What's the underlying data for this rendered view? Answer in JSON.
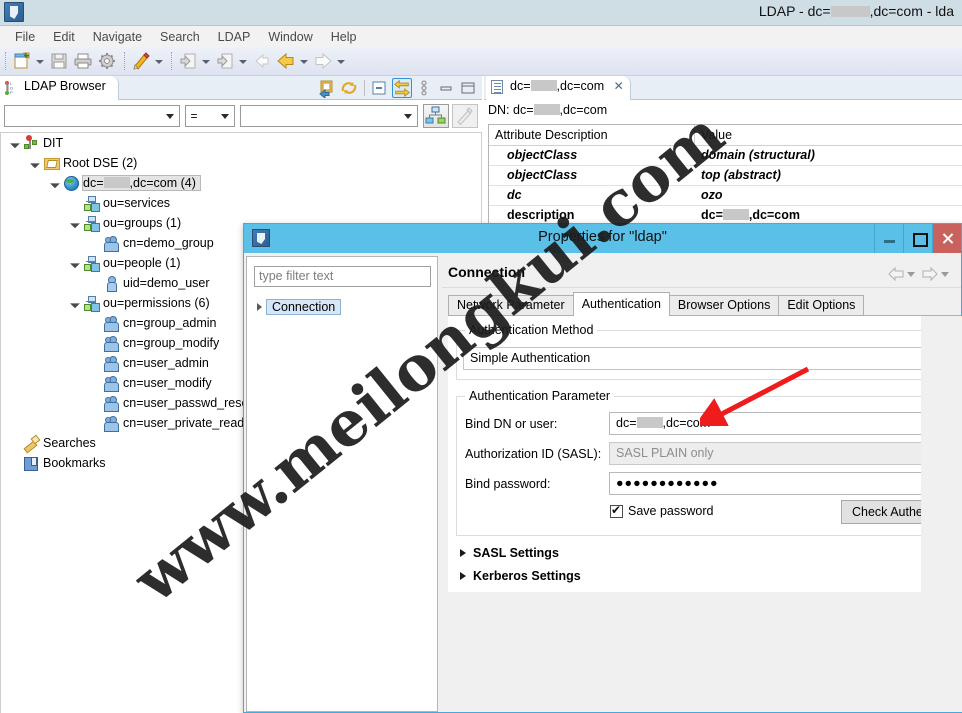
{
  "window": {
    "title": "LDAP - dc=███,dc=com - lda",
    "app_icon": "ldap-studio-icon"
  },
  "menubar": {
    "items": [
      "File",
      "Edit",
      "Navigate",
      "Search",
      "LDAP",
      "Window",
      "Help"
    ]
  },
  "toolbar": {
    "buttons": [
      {
        "name": "new-icon"
      },
      {
        "name": "new-dropdown-arrow"
      },
      {
        "name": "save-icon"
      },
      {
        "name": "print-icon"
      },
      {
        "name": "preferences-gear-icon"
      },
      {
        "name": "ldif-import-icon"
      },
      {
        "name": "ldif-dropdown-arrow"
      },
      {
        "name": "import-icon"
      },
      {
        "name": "import-dropdown-arrow"
      },
      {
        "name": "export-icon"
      },
      {
        "name": "export-dropdown-arrow"
      },
      {
        "name": "back-disabled-icon"
      },
      {
        "name": "back-icon"
      },
      {
        "name": "back-dropdown-arrow"
      },
      {
        "name": "forward-icon"
      },
      {
        "name": "forward-dropdown-arrow"
      }
    ]
  },
  "browser_view": {
    "tab_label": "LDAP Browser",
    "tools": [
      "link-with-editor-icon",
      "refresh-icon",
      "collapse-all-icon",
      "pin-icon",
      "view-menu-icon",
      "minimize-icon",
      "maximize-icon"
    ],
    "filter": {
      "attribute_value": "",
      "operator": "=",
      "value": "",
      "apply_button": "apply-filter-icon",
      "clear_button": "clear-filter-icon"
    },
    "tree": [
      {
        "label": "DIT",
        "indent": 0,
        "icon": "dit-icon",
        "twist": "open",
        "selected": false
      },
      {
        "label": "Root DSE (2)",
        "indent": 1,
        "icon": "root-dse-icon",
        "twist": "open",
        "selected": false
      },
      {
        "label": "dc=██,dc=com (4)",
        "indent": 2,
        "icon": "entry-globe-icon",
        "twist": "open",
        "selected": true
      },
      {
        "label": "ou=services",
        "indent": 3,
        "icon": "ou-icon",
        "twist": "none",
        "selected": false
      },
      {
        "label": "ou=groups (1)",
        "indent": 3,
        "icon": "ou-icon",
        "twist": "open",
        "selected": false
      },
      {
        "label": "cn=demo_group",
        "indent": 4,
        "icon": "group-icon",
        "twist": "none",
        "selected": false
      },
      {
        "label": "ou=people (1)",
        "indent": 3,
        "icon": "ou-icon",
        "twist": "open",
        "selected": false
      },
      {
        "label": "uid=demo_user",
        "indent": 4,
        "icon": "user-icon",
        "twist": "none",
        "selected": false
      },
      {
        "label": "ou=permissions (6)",
        "indent": 3,
        "icon": "ou-icon",
        "twist": "open",
        "selected": false
      },
      {
        "label": "cn=group_admin",
        "indent": 4,
        "icon": "group-icon",
        "twist": "none",
        "selected": false
      },
      {
        "label": "cn=group_modify",
        "indent": 4,
        "icon": "group-icon",
        "twist": "none",
        "selected": false
      },
      {
        "label": "cn=user_admin",
        "indent": 4,
        "icon": "group-icon",
        "twist": "none",
        "selected": false
      },
      {
        "label": "cn=user_modify",
        "indent": 4,
        "icon": "group-icon",
        "twist": "none",
        "selected": false
      },
      {
        "label": "cn=user_passwd_reset",
        "indent": 4,
        "icon": "group-icon",
        "twist": "none",
        "selected": false
      },
      {
        "label": "cn=user_private_read",
        "indent": 4,
        "icon": "group-icon",
        "twist": "none",
        "selected": false
      },
      {
        "label": "Searches",
        "indent": 0,
        "icon": "searches-icon",
        "twist": "none",
        "selected": false
      },
      {
        "label": "Bookmarks",
        "indent": 0,
        "icon": "bookmarks-icon",
        "twist": "none",
        "selected": false
      }
    ]
  },
  "editor": {
    "tab_label": "dc=██,dc=com",
    "tab_close": "✕",
    "dn_line": "DN: dc=██,dc=com",
    "columns": [
      "Attribute Description",
      "Value"
    ],
    "rows": [
      {
        "attribute": "objectClass",
        "value": "domain (structural)"
      },
      {
        "attribute": "objectClass",
        "value": "top (abstract)"
      },
      {
        "attribute": "dc",
        "value": "ozo"
      },
      {
        "attribute": "description",
        "value": "dc=██,dc=com"
      }
    ]
  },
  "dialog": {
    "title": "Properties for \"ldap\"",
    "window_buttons": [
      "minimize-button",
      "maximize-button",
      "close-button"
    ],
    "filter_placeholder": "type filter text",
    "nav_items": [
      {
        "label": "Connection"
      }
    ],
    "page_title": "Connection",
    "page_nav": [
      "back-arrow-icon",
      "back-dropdown-icon",
      "forward-arrow-icon",
      "forward-dropdown-icon"
    ],
    "tabs": [
      {
        "label": "Network Parameter",
        "active": false
      },
      {
        "label": "Authentication",
        "active": true
      },
      {
        "label": "Browser Options",
        "active": false
      },
      {
        "label": "Edit Options",
        "active": false
      }
    ],
    "authentication": {
      "method_group_label": "Authentication Method",
      "method_value": "Simple Authentication",
      "parameter_group_label": "Authentication Parameter",
      "bind_dn_label": "Bind DN or user:",
      "bind_dn_value": "dc=██,dc=com",
      "authz_label": "Authorization ID (SASL):",
      "authz_placeholder": "SASL PLAIN only",
      "password_label": "Bind password:",
      "password_value": "●●●●●●●●●●●●",
      "save_password_label": "Save password",
      "check_auth_label": "Check Authentication",
      "sasl_settings_label": "SASL Settings",
      "kerberos_settings_label": "Kerberos Settings"
    }
  },
  "annotations": {
    "arrow_color": "#ee1c1c",
    "watermark_text": "www.meilongkui.com"
  },
  "colors": {
    "dialog_title_bg": "#5bc0e8",
    "close_button_bg": "#c9625c",
    "titlebar_bg": "#cfdde4",
    "tab_active_bg": "#ffffff"
  }
}
